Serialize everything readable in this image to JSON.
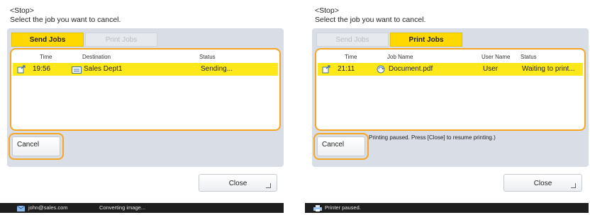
{
  "left": {
    "stop_title": "<Stop>",
    "instruction": "Select the job you want to cancel.",
    "tabs": [
      {
        "label": "Send Jobs",
        "active": true
      },
      {
        "label": "Print Jobs",
        "active": false
      }
    ],
    "columns": {
      "time": "Time",
      "destination": "Destination",
      "status": "Status"
    },
    "row": {
      "time": "19:56",
      "destination": "Sales Dept1",
      "status": "Sending..."
    },
    "cancel_label": "Cancel",
    "close_label": "Close",
    "status_bar": {
      "email": "john@sales.com",
      "message": "Converting image..."
    }
  },
  "right": {
    "stop_title": "<Stop>",
    "instruction": "Select the job you want to cancel.",
    "tabs": [
      {
        "label": "Send Jobs",
        "active": false
      },
      {
        "label": "Print Jobs",
        "active": true
      }
    ],
    "columns": {
      "time": "Time",
      "job_name": "Job Name",
      "user_name": "User Name",
      "status": "Status"
    },
    "row": {
      "time": "21:11",
      "job_name": "Document.pdf",
      "user_name": "User",
      "status": "Waiting to print..."
    },
    "cancel_label": "Cancel",
    "message": "Printing paused. Press [Close] to resume printing.)",
    "close_label": "Close",
    "status_bar": {
      "message": "Printer paused."
    }
  },
  "colors": {
    "accent_yellow": "#ffd800",
    "highlight_orange": "#f5a623",
    "panel": "#d9dde5",
    "statusbar": "#1e1e1e"
  }
}
